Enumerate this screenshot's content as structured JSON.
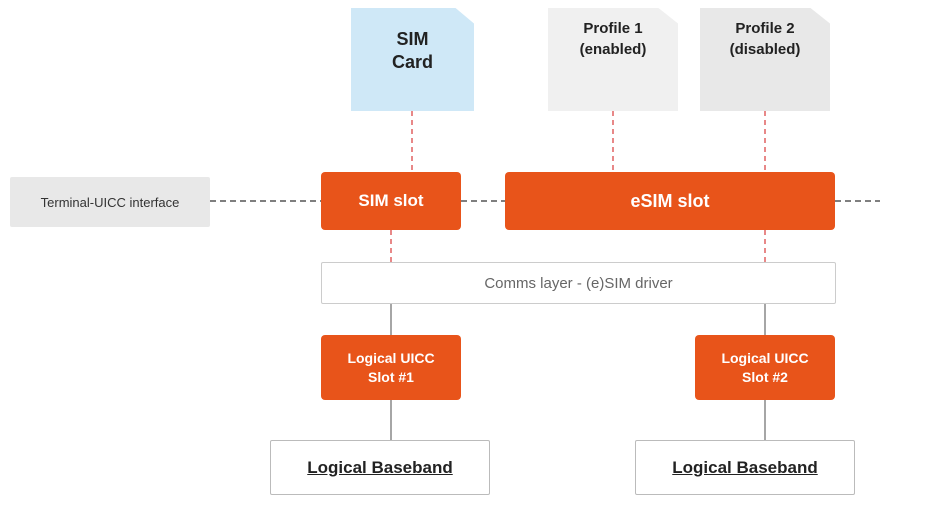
{
  "sim_card": {
    "label": "SIM\nCard"
  },
  "profile1": {
    "label": "Profile 1\n(enabled)"
  },
  "profile2": {
    "label": "Profile 2\n(disabled)"
  },
  "terminal": {
    "label": "Terminal-UICC interface"
  },
  "sim_slot": {
    "label": "SIM slot"
  },
  "esim_slot": {
    "label": "eSIM slot"
  },
  "comms": {
    "label": "Comms layer - (e)SIM driver"
  },
  "logical1": {
    "label": "Logical UICC\nSlot #1"
  },
  "logical2": {
    "label": "Logical UICC\nSlot #2"
  },
  "baseband1": {
    "label": "Logical  Baseband"
  },
  "baseband2": {
    "label": "Logical Baseband"
  }
}
